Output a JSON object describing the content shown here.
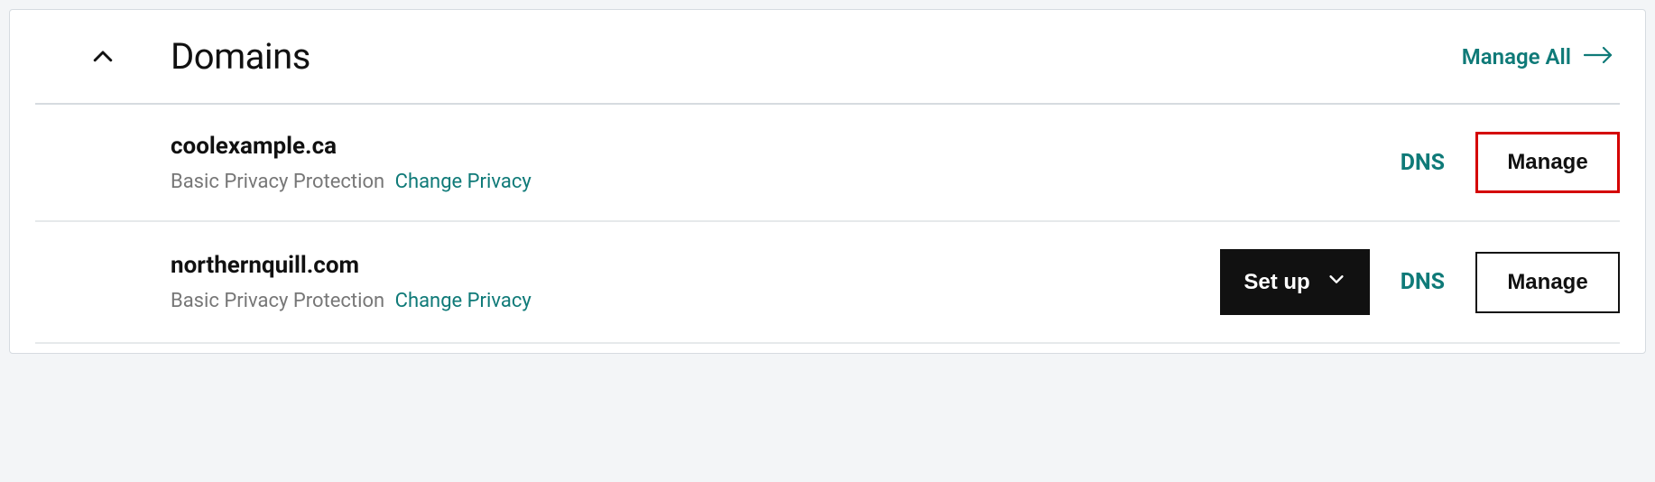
{
  "header": {
    "title": "Domains",
    "manage_all_label": "Manage All"
  },
  "rows": [
    {
      "domain": "coolexample.ca",
      "privacy_text": "Basic Privacy Protection",
      "change_privacy_label": "Change Privacy",
      "has_setup": false,
      "setup_label": "",
      "dns_label": "DNS",
      "manage_label": "Manage",
      "highlight_manage": true
    },
    {
      "domain": "northernquill.com",
      "privacy_text": "Basic Privacy Protection",
      "change_privacy_label": "Change Privacy",
      "has_setup": true,
      "setup_label": "Set up",
      "dns_label": "DNS",
      "manage_label": "Manage",
      "highlight_manage": false
    }
  ]
}
